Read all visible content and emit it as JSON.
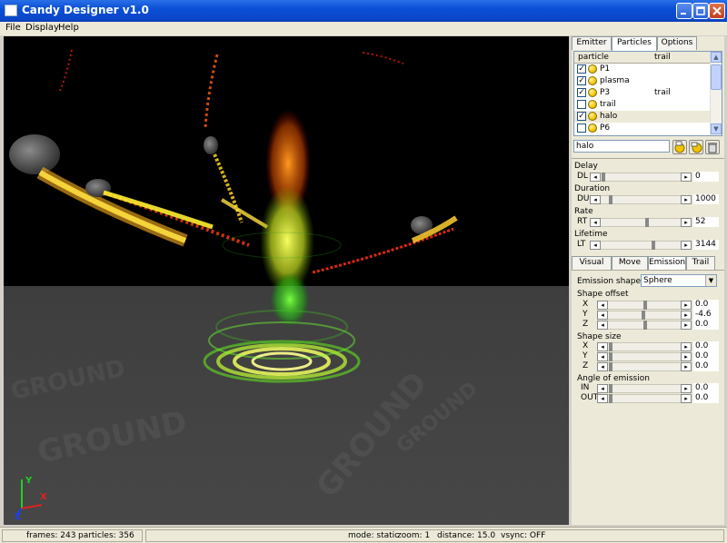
{
  "window": {
    "title": "Candy Designer v1.0"
  },
  "menu": [
    "File",
    "Display",
    "Help"
  ],
  "top_tabs": [
    "Emitter",
    "Particles",
    "Options"
  ],
  "particle_list": {
    "headers": [
      "particle",
      "trail"
    ],
    "rows": [
      {
        "checked": true,
        "name": "P1",
        "trail": ""
      },
      {
        "checked": true,
        "name": "plasma",
        "trail": ""
      },
      {
        "checked": true,
        "name": "P3",
        "trail": "trail"
      },
      {
        "checked": false,
        "name": "trail",
        "trail": ""
      },
      {
        "checked": true,
        "name": "halo",
        "trail": "",
        "selected": true
      },
      {
        "checked": false,
        "name": "P6",
        "trail": ""
      }
    ]
  },
  "selected_name": "halo",
  "params": [
    {
      "label": "Delay",
      "code": "DL",
      "value": "0",
      "level": 0.0
    },
    {
      "label": "Duration",
      "code": "DU",
      "value": "1000",
      "level": 0.1
    },
    {
      "label": "Rate",
      "code": "RT",
      "value": "52",
      "level": 0.57
    },
    {
      "label": "Lifetime",
      "code": "LT",
      "value": "3144",
      "level": 0.65
    }
  ],
  "bottom_tabs": [
    "Visual",
    "Move",
    "Emission",
    "Trail"
  ],
  "emission": {
    "shape_label": "Emission shape",
    "shape_value": "Sphere",
    "offset_label": "Shape offset",
    "offset": [
      {
        "axis": "X",
        "value": "0.0",
        "level": 0.5
      },
      {
        "axis": "Y",
        "value": "-4.6",
        "level": 0.47
      },
      {
        "axis": "Z",
        "value": "0.0",
        "level": 0.5
      }
    ],
    "size_label": "Shape size",
    "size": [
      {
        "axis": "X",
        "value": "0.0",
        "level": 0.0
      },
      {
        "axis": "Y",
        "value": "0.0",
        "level": 0.0
      },
      {
        "axis": "Z",
        "value": "0.0",
        "level": 0.0
      }
    ],
    "angle_label": "Angle of emission",
    "angle": [
      {
        "axis": "IN",
        "value": "0.0",
        "level": 0.0
      },
      {
        "axis": "OUT",
        "value": "0.0",
        "level": 0.0
      }
    ]
  },
  "viewport": {
    "ground_text": "GROUND",
    "axes": {
      "x": "X",
      "y": "Y",
      "z": "Z"
    }
  },
  "status": {
    "frames": "frames: 243",
    "particles": "particles: 356",
    "mode": "mode: static",
    "zoom": "zoom: 1",
    "distance": "distance: 15.0",
    "vsync": "vsync: OFF"
  },
  "colors": {
    "titlebar": "#0a4fd6",
    "panel": "#ece9d8",
    "viewport_bg": "#000000"
  }
}
